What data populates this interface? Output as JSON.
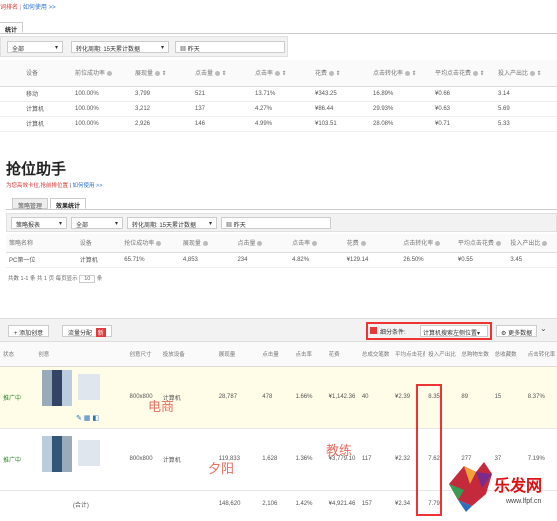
{
  "top": {
    "breadcrumb_a": "词排名",
    "breadcrumb_b": "如何使用 >>",
    "tab_label": "统计",
    "filter_scope": "全部",
    "filter_period": "转化周期:  15天累计数据",
    "filter_date": "昨天",
    "columns": [
      "设备",
      "前位成功率",
      "展现量",
      "点击量",
      "点击率",
      "花费",
      "点击转化率",
      "平均点击花费",
      "投入产出比"
    ],
    "rows": [
      [
        "移动",
        "100.00%",
        "3,799",
        "521",
        "13.71%",
        "¥343.25",
        "16.89%",
        "¥0.66",
        "3.14"
      ],
      [
        "计算机",
        "100.00%",
        "3,212",
        "137",
        "4.27%",
        "¥86.44",
        "29.93%",
        "¥0.63",
        "5.69"
      ],
      [
        "计算机",
        "100.00%",
        "2,926",
        "146",
        "4.99%",
        "¥103.51",
        "28.08%",
        "¥0.71",
        "5.33"
      ]
    ]
  },
  "mid": {
    "title": "抢位助手",
    "subtitle_red": "为您高效卡位,抢前排位置",
    "subtitle_link": "如何使用 >>",
    "tabs": [
      "策略管理",
      "效果统计"
    ],
    "filter_report": "策略报表",
    "filter_scope": "全部",
    "filter_period": "转化周期:  15天累计数据",
    "filter_date": "昨天",
    "columns": [
      "策略名称",
      "设备",
      "抢位成功率",
      "展现量",
      "点击量",
      "点击率",
      "花费",
      "点击转化率",
      "平均点击花费",
      "投入产出比"
    ],
    "rows": [
      [
        "PC第一位",
        "计算机",
        "65.71%",
        "4,853",
        "234",
        "4.82%",
        "¥129.14",
        "26.50%",
        "¥0.55",
        "3.45"
      ]
    ],
    "pager": "共数 1-1 条    共 1 页    每页显示",
    "page_size": "10",
    "page_unit": "条"
  },
  "bottom": {
    "add_button": "+ 添加创意",
    "flow_button": "流量分配",
    "flow_badge": "新",
    "filter_label": "细分条件:",
    "filter_value": "计算机搜索左侧位置",
    "more_data": "更多数据",
    "columns": [
      "状态",
      "创意",
      "创意尺寸",
      "投放设备",
      "展现量",
      "点击量",
      "点击率",
      "花费",
      "总成交笔数",
      "平均点击花费",
      "投入产出比",
      "总购物车数",
      "总收藏数",
      "点击转化率"
    ],
    "rows": [
      {
        "status": "推广中",
        "size": "800x800",
        "device": "计算机",
        "impr": "28,787",
        "clicks": "478",
        "ctr": "1.66%",
        "cost": "¥1,142.36",
        "orders": "40",
        "cpc": "¥2.39",
        "roi": "8.35",
        "cart": "89",
        "fav": "15",
        "conv": "8.37%"
      },
      {
        "status": "推广中",
        "size": "800x800",
        "device": "计算机",
        "impr": "119,833",
        "clicks": "1,628",
        "ctr": "1.36%",
        "cost": "¥3,779.10",
        "orders": "117",
        "cpc": "¥2.32",
        "roi": "7.62",
        "cart": "277",
        "fav": "37",
        "conv": "7.19%"
      }
    ],
    "total": {
      "label": "(合计)",
      "impr": "148,620",
      "clicks": "2,106",
      "ctr": "1.42%",
      "cost": "¥4,921.46",
      "orders": "157",
      "cpc": "¥2.34",
      "roi": "7.79"
    }
  },
  "watermarks": {
    "w1": "电商",
    "w2": "夕阳",
    "w3": "教练",
    "logo_text": "乐发网",
    "logo_url": "www.lfpf.cn"
  }
}
